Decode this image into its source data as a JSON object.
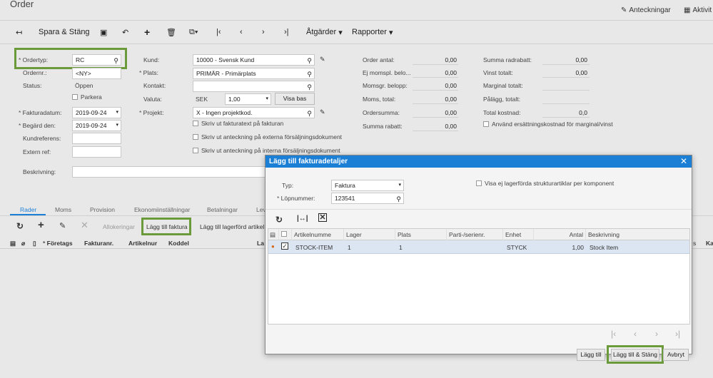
{
  "page": {
    "title": "Order",
    "notes": "Anteckningar",
    "activities": "Aktivit"
  },
  "toolbar": {
    "save_close": "Spara & Stäng",
    "actions": "Åtgärder",
    "reports": "Rapporter"
  },
  "form": {
    "ordertype_label": "Ordertyp:",
    "ordertype": "RC",
    "ordernr_label": "Ordernr.:",
    "ordernr": "<NY>",
    "status_label": "Status:",
    "status": "Öppen",
    "park_label": "Parkera",
    "invoicedate_label": "Fakturadatum:",
    "invoicedate": "2019-09-24",
    "requested_label": "Begärd den:",
    "requested": "2019-09-24",
    "custref_label": "Kundreferens:",
    "extref_label": "Extern ref:",
    "desc_label": "Beskrivning:",
    "customer_label": "Kund:",
    "customer": "10000 - Svensk Kund",
    "location_label": "Plats:",
    "location": "PRIMÄR - Primärplats",
    "contact_label": "Kontakt:",
    "currency_label": "Valuta:",
    "currency": "SEK",
    "rate": "1,00",
    "viewbase": "Visa bas",
    "project_label": "Projekt:",
    "project": "X - Ingen projektkod.",
    "chk1": "Skriv ut fakturatext på fakturan",
    "chk2": "Skriv ut anteckning på externa försäljningsdokument",
    "chk3": "Skriv ut anteckning på interna försäljningsdokument"
  },
  "totals_mid": [
    {
      "label": "Order antal:",
      "value": "0,00"
    },
    {
      "label": "Ej momspl. belo...",
      "value": "0,00"
    },
    {
      "label": "Momsgr. belopp:",
      "value": "0,00"
    },
    {
      "label": "Moms, total:",
      "value": "0,00"
    },
    {
      "label": "Ordersumma:",
      "value": "0,00"
    },
    {
      "label": "Summa rabatt:",
      "value": "0,00"
    }
  ],
  "totals_right": [
    {
      "label": "Summa radrabatt:",
      "value": "0,00"
    },
    {
      "label": "Vinst totalt:",
      "value": "0,00"
    },
    {
      "label": "Marginal totalt:",
      "value": ""
    },
    {
      "label": "Pålägg, totalt:",
      "value": ""
    },
    {
      "label": "Total kostnad:",
      "value": "0,0"
    }
  ],
  "use_replacement": "Använd ersättningskostnad för marginal/vinst",
  "tabs": [
    "Rader",
    "Moms",
    "Provision",
    "Ekonomiinställningar",
    "Betalningar",
    "Lev"
  ],
  "grid_toolbar": {
    "allocations": "Allokeringar",
    "add_invoice": "Lägg till faktura",
    "add_stock": "Lägg till lagerförd artikel"
  },
  "grid_headers": [
    "Företags",
    "Fakturanr.",
    "Artikelnur",
    "Koddel",
    "La"
  ],
  "dialog": {
    "title": "Lägg till fakturadetaljer",
    "type_label": "Typ:",
    "type": "Faktura",
    "serial_label": "Löpnummer:",
    "serial": "123541",
    "show_label": "Visa ej lagerförda strukturartiklar per komponent",
    "headers": [
      "Artikelnumme",
      "Lager",
      "Plats",
      "Parti-/serienr.",
      "Enhet",
      "Antal",
      "Beskrivning"
    ],
    "row": {
      "item": "STOCK-ITEM",
      "warehouse": "1",
      "location": "1",
      "lot": "",
      "unit": "STYCK",
      "qty": "1,00",
      "desc": "Stock Item"
    },
    "add": "Lägg till",
    "add_close": "Lägg till & Stäng",
    "cancel": "Avbryt"
  },
  "peek": {
    "s": "s",
    "ka": "Ka"
  }
}
